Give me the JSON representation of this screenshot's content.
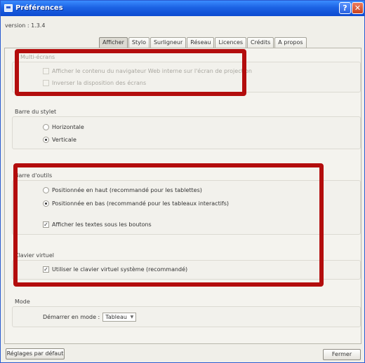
{
  "window": {
    "title": "Préférences"
  },
  "version": "version : 1.3.4",
  "tabs": [
    {
      "label": "Afficher",
      "active": true
    },
    {
      "label": "Stylo"
    },
    {
      "label": "Surligneur"
    },
    {
      "label": "Réseau"
    },
    {
      "label": "Licences"
    },
    {
      "label": "Crédits"
    },
    {
      "label": "A propos"
    }
  ],
  "sections": {
    "multi": {
      "title": "Multi-écrans",
      "items": [
        {
          "label": "Afficher le contenu du navigateur Web interne sur l'écran de projection",
          "checked": false,
          "enabled": false
        },
        {
          "label": "Inverser la disposition des écrans",
          "checked": false,
          "enabled": false
        }
      ]
    },
    "stylet": {
      "title": "Barre du stylet",
      "options": [
        {
          "label": "Horizontale",
          "selected": false
        },
        {
          "label": "Verticale",
          "selected": true
        }
      ]
    },
    "outils": {
      "title": "Barre d'outils",
      "options": [
        {
          "label": "Positionnée en haut (recommandé pour les tablettes)",
          "selected": false
        },
        {
          "label": "Positionnée en bas (recommandé pour les tableaux interactifs)",
          "selected": true
        }
      ],
      "checkbox": {
        "label": "Afficher les textes sous les boutons",
        "checked": true
      }
    },
    "clavier": {
      "title": "Clavier virtuel",
      "checkbox": {
        "label": "Utiliser le clavier virtuel système (recommandé)",
        "checked": true
      }
    },
    "mode": {
      "title": "Mode",
      "label": "Démarrer en mode :",
      "value": "Tableau"
    }
  },
  "buttons": {
    "defaults": "Réglages par défaut",
    "close": "Fermer"
  },
  "colors": {
    "annotation": "#b30d0d",
    "titlebar": "#1c62e3"
  },
  "checkmark": "✓"
}
